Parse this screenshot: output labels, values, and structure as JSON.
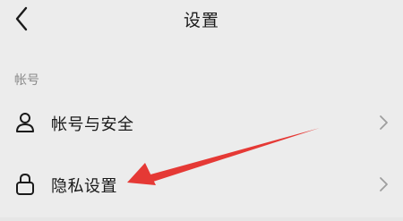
{
  "header": {
    "title": "设置",
    "back_icon": "chevron-left-icon"
  },
  "section": {
    "label": "帐号"
  },
  "items": [
    {
      "label": "帐号与安全",
      "icon": "person-icon"
    },
    {
      "label": "隐私设置",
      "icon": "lock-icon"
    }
  ],
  "annotation": {
    "type": "red-arrow",
    "target": "隐私设置",
    "color": "#e53935"
  },
  "colors": {
    "background": "#ececec",
    "text": "#1a1a1a",
    "muted": "#8a8a8a",
    "chevron": "#9e9e9e"
  }
}
